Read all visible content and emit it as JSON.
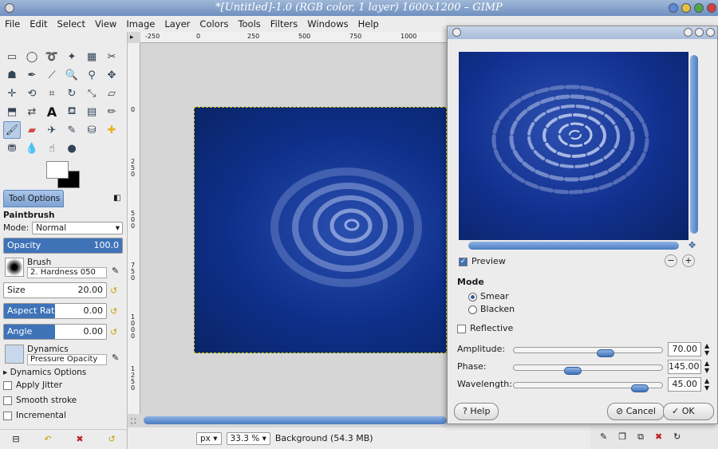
{
  "window": {
    "title": "*[Untitled]-1.0 (RGB color, 1 layer) 1600x1200 – GIMP"
  },
  "menu": [
    "File",
    "Edit",
    "Select",
    "View",
    "Image",
    "Layer",
    "Colors",
    "Tools",
    "Filters",
    "Windows",
    "Help"
  ],
  "ruler": {
    "h_ticks": [
      "-250",
      "0",
      "250",
      "500",
      "750",
      "1000"
    ],
    "v_ticks": [
      "0",
      "2\n5\n0",
      "5\n0\n0",
      "7\n5\n0",
      "1\n0\n0\n0",
      "1\n2\n5\n0"
    ]
  },
  "tool_options": {
    "tab_label": "Tool Options",
    "tool_name": "Paintbrush",
    "mode_label": "Mode:",
    "mode_value": "Normal",
    "opacity_label": "Opacity",
    "opacity_value": "100.0",
    "opacity_fraction": 1.0,
    "brush_label": "Brush",
    "brush_value": "2. Hardness 050",
    "size_label": "Size",
    "size_value": "20.00",
    "aspect_label": "Aspect Ratio",
    "aspect_value": "0.00",
    "aspect_fraction": 0.5,
    "angle_label": "Angle",
    "angle_value": "0.00",
    "angle_fraction": 0.5,
    "dynamics_label": "Dynamics",
    "dynamics_value": "Pressure Opacity",
    "dynamics_options": "Dynamics Options",
    "jitter": "Apply Jitter",
    "smooth": "Smooth stroke",
    "incremental": "Incremental"
  },
  "status": {
    "unit": "px",
    "zoom": "33.3 %",
    "info": "Background (54.3 MB)"
  },
  "dialog": {
    "preview_label": "Preview",
    "mode_heading": "Mode",
    "smear_label": "Smear",
    "blacken_label": "Blacken",
    "reflective_label": "Reflective",
    "amplitude_label": "Amplitude:",
    "amplitude_value": "70.00",
    "amplitude_fraction": 0.62,
    "phase_label": "Phase:",
    "phase_value": "145.00",
    "phase_fraction": 0.4,
    "wavelength_label": "Wavelength:",
    "wavelength_value": "45.00",
    "wavelength_fraction": 0.85,
    "help_label": "Help",
    "cancel_label": "Cancel",
    "ok_label": "OK"
  },
  "colors": {
    "accent": "#3f73b8",
    "image_blue": "#0e2f8a"
  }
}
